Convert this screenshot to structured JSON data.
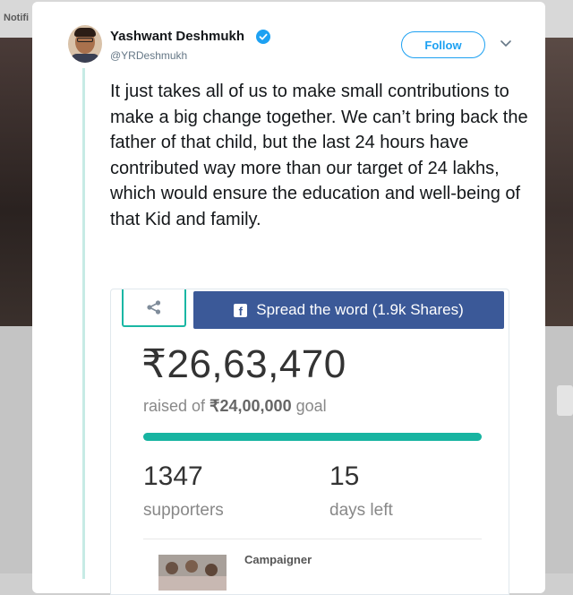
{
  "background": {
    "notification_tab": "Notifi"
  },
  "tweet": {
    "author_name": "Yashwant Deshmukh",
    "author_handle": "@YRDeshmukh",
    "follow_label": "Follow",
    "text": "It just takes all of us to make small contributions to make a big change together. We can’t bring back the father of that child, but the last 24 hours have contributed way more than our target of 24 lakhs, which would ensure the education and well-being of that Kid and family."
  },
  "fundraiser": {
    "spread_label": "Spread the word (1.9k Shares)",
    "amount_raised": "₹26,63,470",
    "goal_prefix": "raised of ",
    "goal_amount": "₹24,00,000",
    "goal_suffix": " goal",
    "progress_fraction": 1.0,
    "supporters_count": "1347",
    "supporters_label": "supporters",
    "days_left_count": "15",
    "days_left_label": "days left",
    "campaigner_label": "Campaigner"
  },
  "colors": {
    "twitter_blue": "#1da1f2",
    "facebook_blue": "#3b5998",
    "progress_teal": "#17b4a1"
  },
  "icons": [
    "verified-badge-icon",
    "chevron-down-icon",
    "share-icon",
    "facebook-icon"
  ]
}
